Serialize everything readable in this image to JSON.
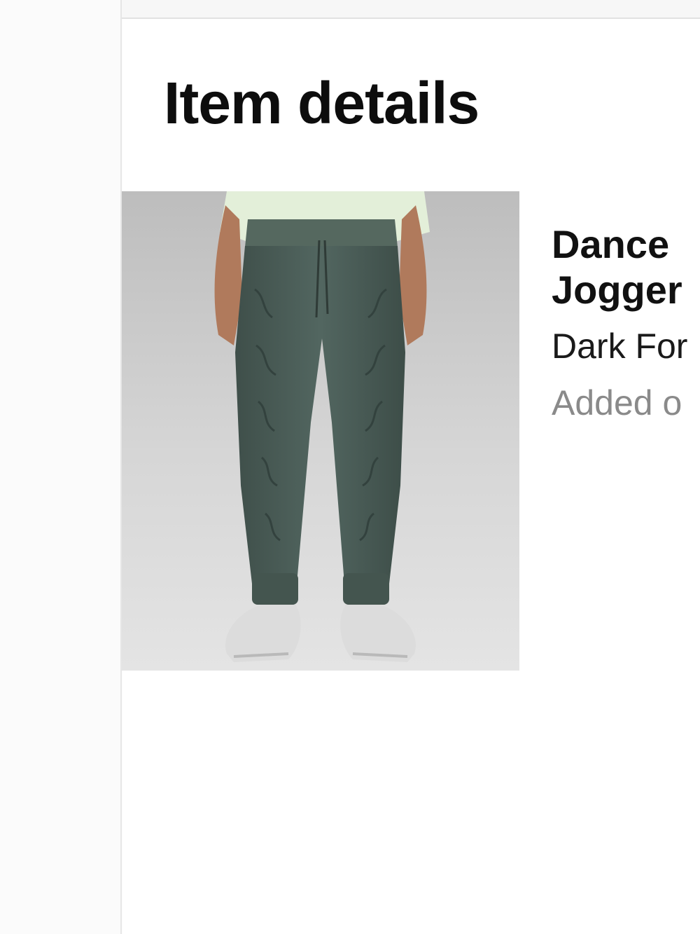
{
  "page": {
    "title": "Item details"
  },
  "product": {
    "name_line1": "Dance",
    "name_line2": "Jogger",
    "color": "Dark For",
    "added": "Added o",
    "image_icon": "product-photo-jogger-pants",
    "pants_color": "#4a5a55"
  }
}
